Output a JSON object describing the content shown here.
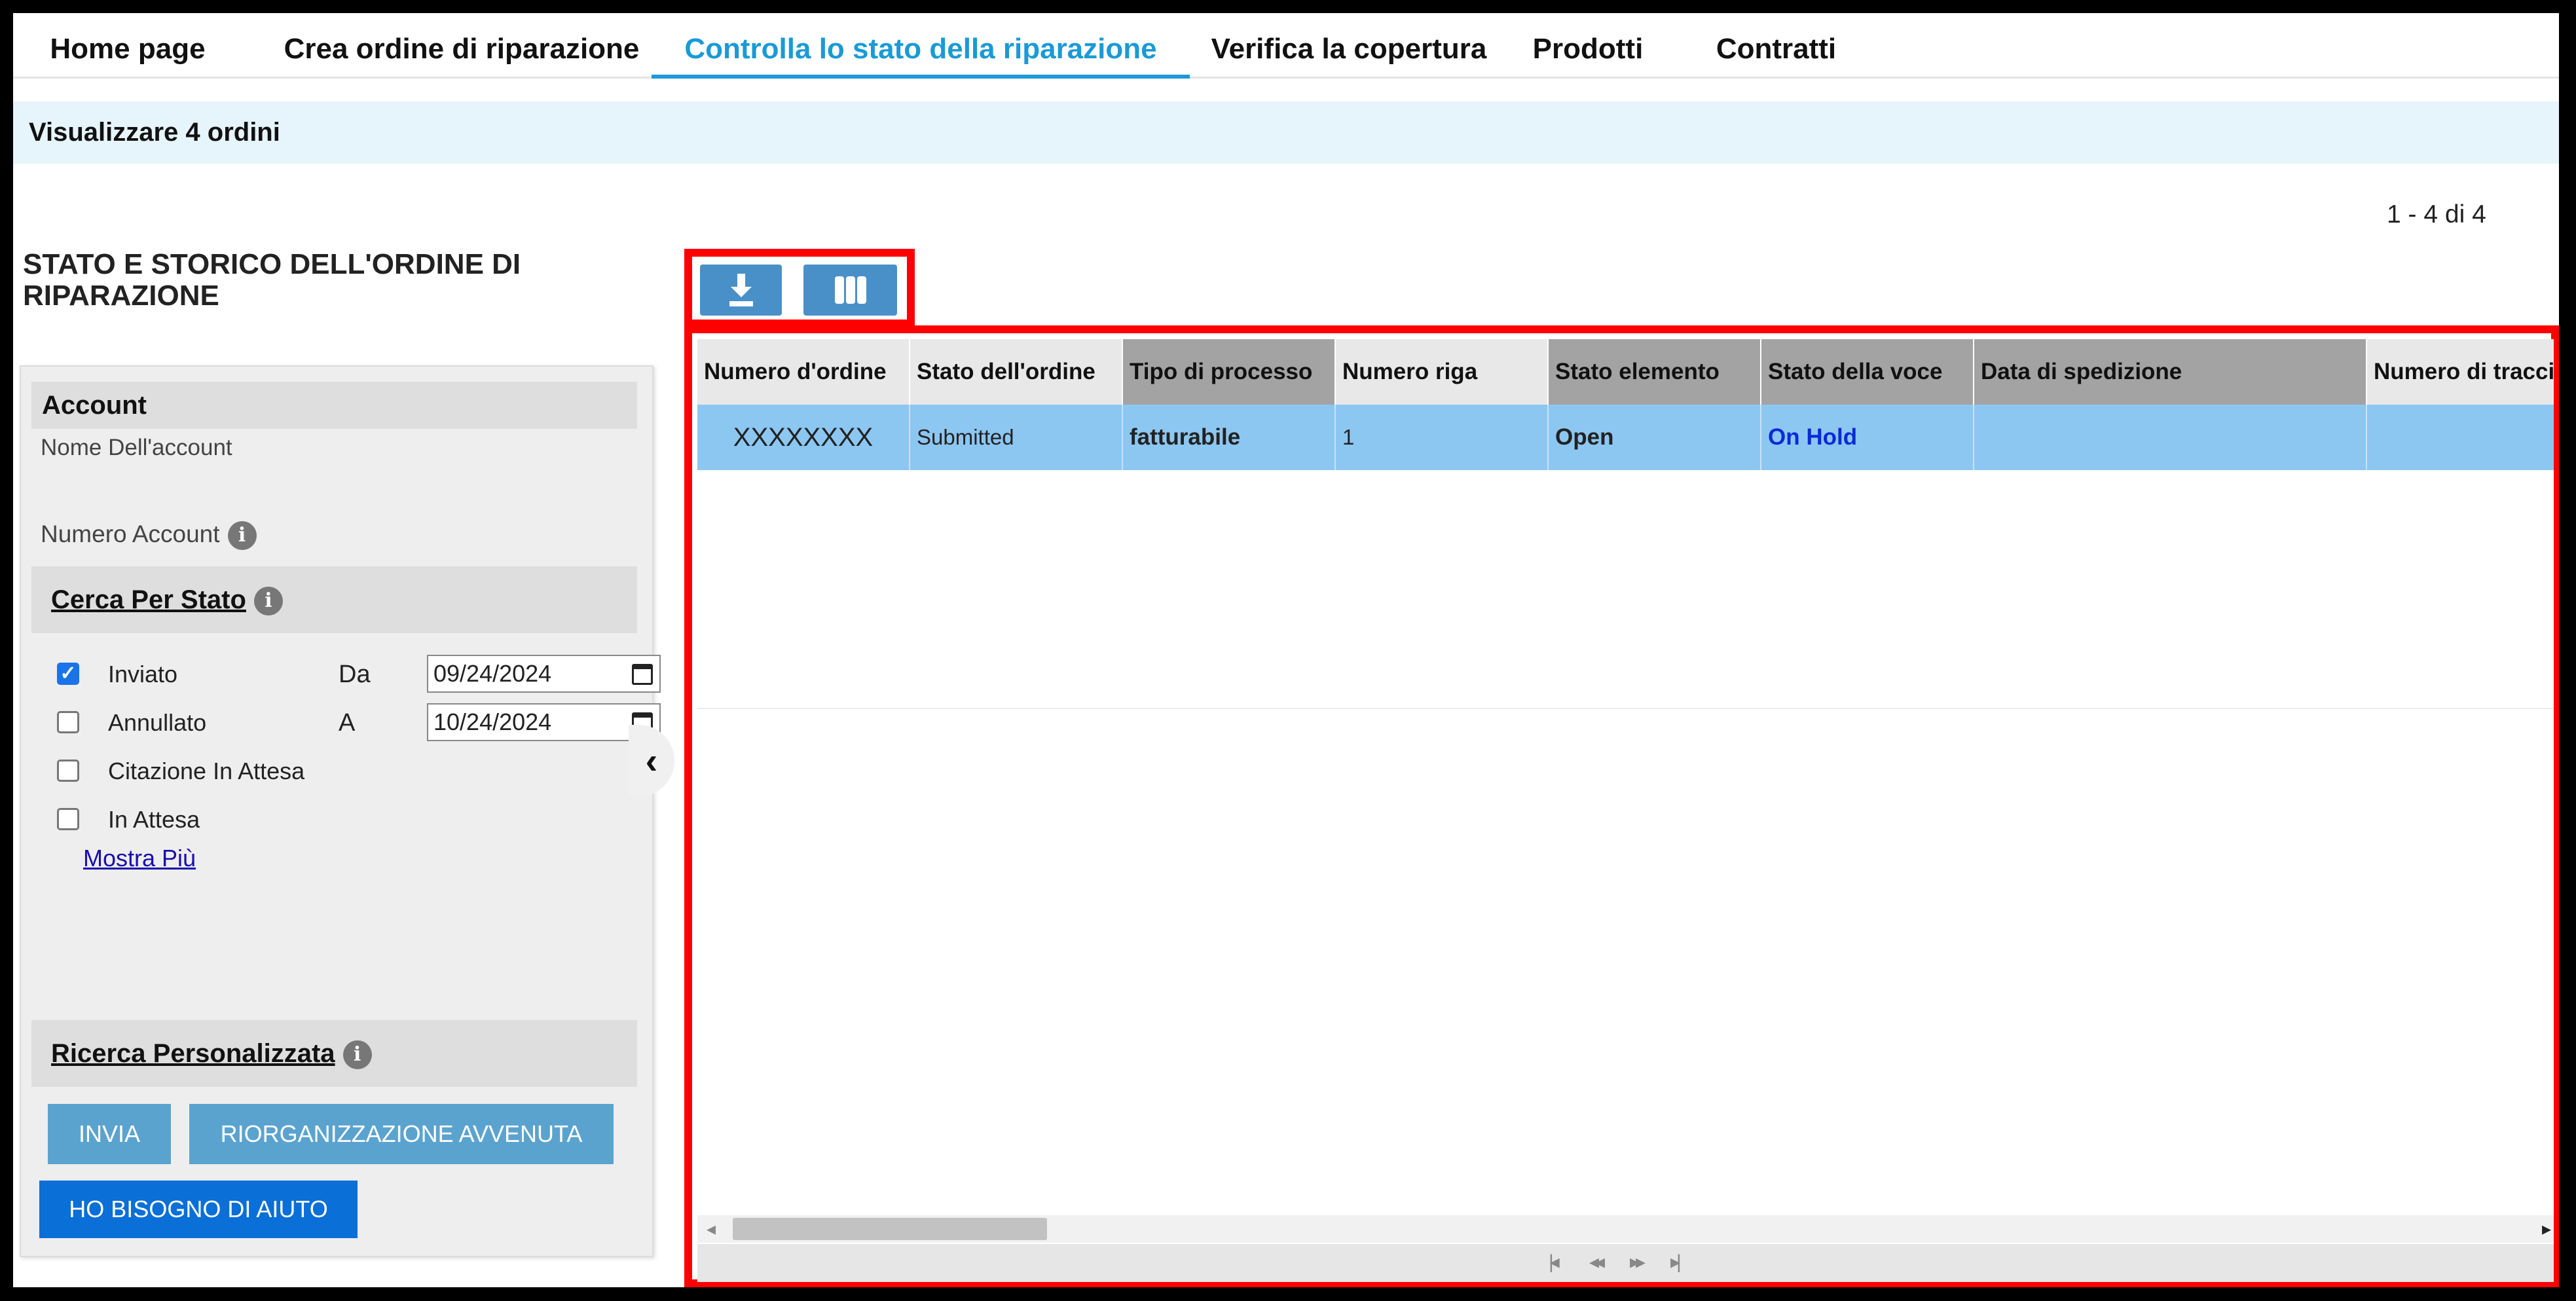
{
  "nav": {
    "tabs": [
      {
        "label": "Home page"
      },
      {
        "label": "Crea ordine di riparazione"
      },
      {
        "label": "Controlla lo stato della riparazione"
      },
      {
        "label": "Verifica la copertura"
      },
      {
        "label": "Prodotti"
      },
      {
        "label": "Contratti"
      }
    ],
    "active_tab": "Controlla lo stato della riparazione",
    "accent_color": "#1a9ad6"
  },
  "info_bar": {
    "text": "Visualizzare 4 ordini"
  },
  "pager": {
    "count_text": "1 - 4 di 4"
  },
  "section_title": "STATO E STORICO DELL'ORDINE DI RIPARAZIONE",
  "sidebar": {
    "account": {
      "title": "Account",
      "name_label": "Nome Dell'account",
      "number_label": "Numero Account"
    },
    "search_by_state": {
      "title": "Cerca Per Stato",
      "options": [
        {
          "label": "Inviato",
          "checked": true
        },
        {
          "label": "Annullato",
          "checked": false
        },
        {
          "label": "Citazione In Attesa",
          "checked": false
        },
        {
          "label": "In Attesa",
          "checked": false
        }
      ],
      "from_label": "Da",
      "from_value": "09/24/2024",
      "to_label": "A",
      "to_value": "10/24/2024",
      "more_link": "Mostra Più"
    },
    "custom_search": {
      "title": "Ricerca Personalizzata"
    },
    "buttons": {
      "submit": "INVIA",
      "reorg": "RIORGANIZZAZIONE AVVENUTA",
      "help": "HO BISOGNO DI AIUTO"
    }
  },
  "toolbar": {
    "download_icon": "download-icon",
    "columns_icon": "columns-icon",
    "highlight_color": "#ff0000"
  },
  "grid": {
    "columns": [
      "Numero d'ordine",
      "Stato dell'ordine",
      "Tipo di processo",
      "Numero riga",
      "Stato elemento",
      "Stato della voce",
      "Data di spedizione",
      "Numero di tracci"
    ],
    "rows": [
      {
        "order_number": "XXXXXXXX",
        "order_status": "Submitted",
        "process_type": "fatturabile",
        "line_number": "1",
        "item_status": "Open",
        "entry_status": "On Hold",
        "ship_date": "",
        "tracking": ""
      }
    ],
    "selected_row_color": "#8cc7f2"
  }
}
